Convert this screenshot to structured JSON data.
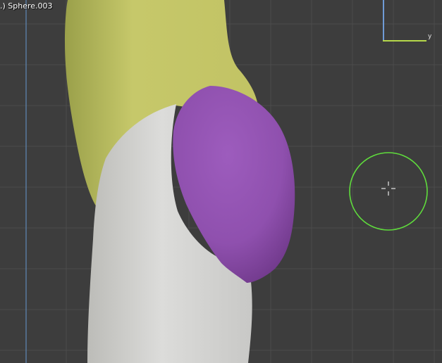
{
  "viewport": {
    "object_label": ".) Sphere.003",
    "axis_y_label": "y",
    "colors": {
      "background": "#3d3d3d",
      "grid_minor": "#4a4a4a",
      "grid_major_x": "#5a87b4",
      "axis_y": "#b6d84a",
      "axis_z": "#6f9bd6",
      "torso": "#c3c465",
      "leg": "#d8d8d6",
      "glute": "#9556b4",
      "brush_circle": "#5fdc3c"
    },
    "icons": {
      "cursor": "crosshair-3d-cursor-icon",
      "brush": "sculpt-brush-circle-icon"
    }
  }
}
